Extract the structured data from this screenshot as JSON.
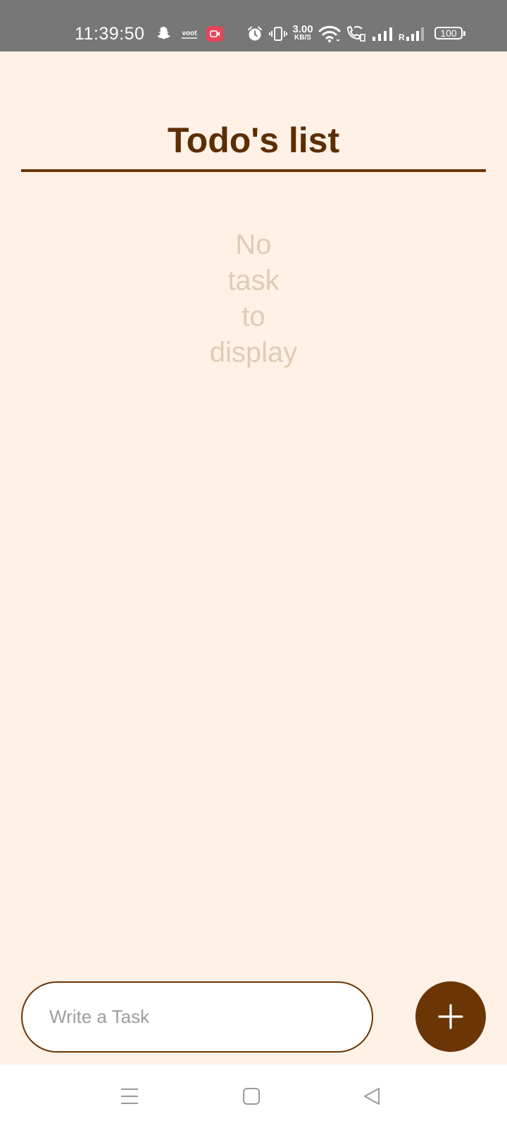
{
  "status_bar": {
    "time": "11:39:50",
    "net_speed_value": "3.00",
    "net_speed_unit": "KB/S",
    "roaming_label": "R",
    "battery_level": "100",
    "icons": [
      "snapchat-icon",
      "voot-icon",
      "screen-record-icon",
      "alarm-icon",
      "vibrate-icon",
      "wifi-icon",
      "wifi-calling-icon",
      "signal-icon",
      "signal-roaming-icon",
      "battery-icon"
    ]
  },
  "header": {
    "title": "Todo's list"
  },
  "empty_state": {
    "message": "No task to display"
  },
  "composer": {
    "input_value": "",
    "input_placeholder": "Write a Task",
    "add_button_icon": "plus-icon"
  },
  "colors": {
    "background": "#FFF1E6",
    "accent": "#6B3505",
    "title": "#5C2E02",
    "empty_text": "#E1CBB5",
    "status_bar": "#777777"
  },
  "nav_bar": {
    "icons": [
      "recents-icon",
      "home-icon",
      "back-icon"
    ]
  }
}
